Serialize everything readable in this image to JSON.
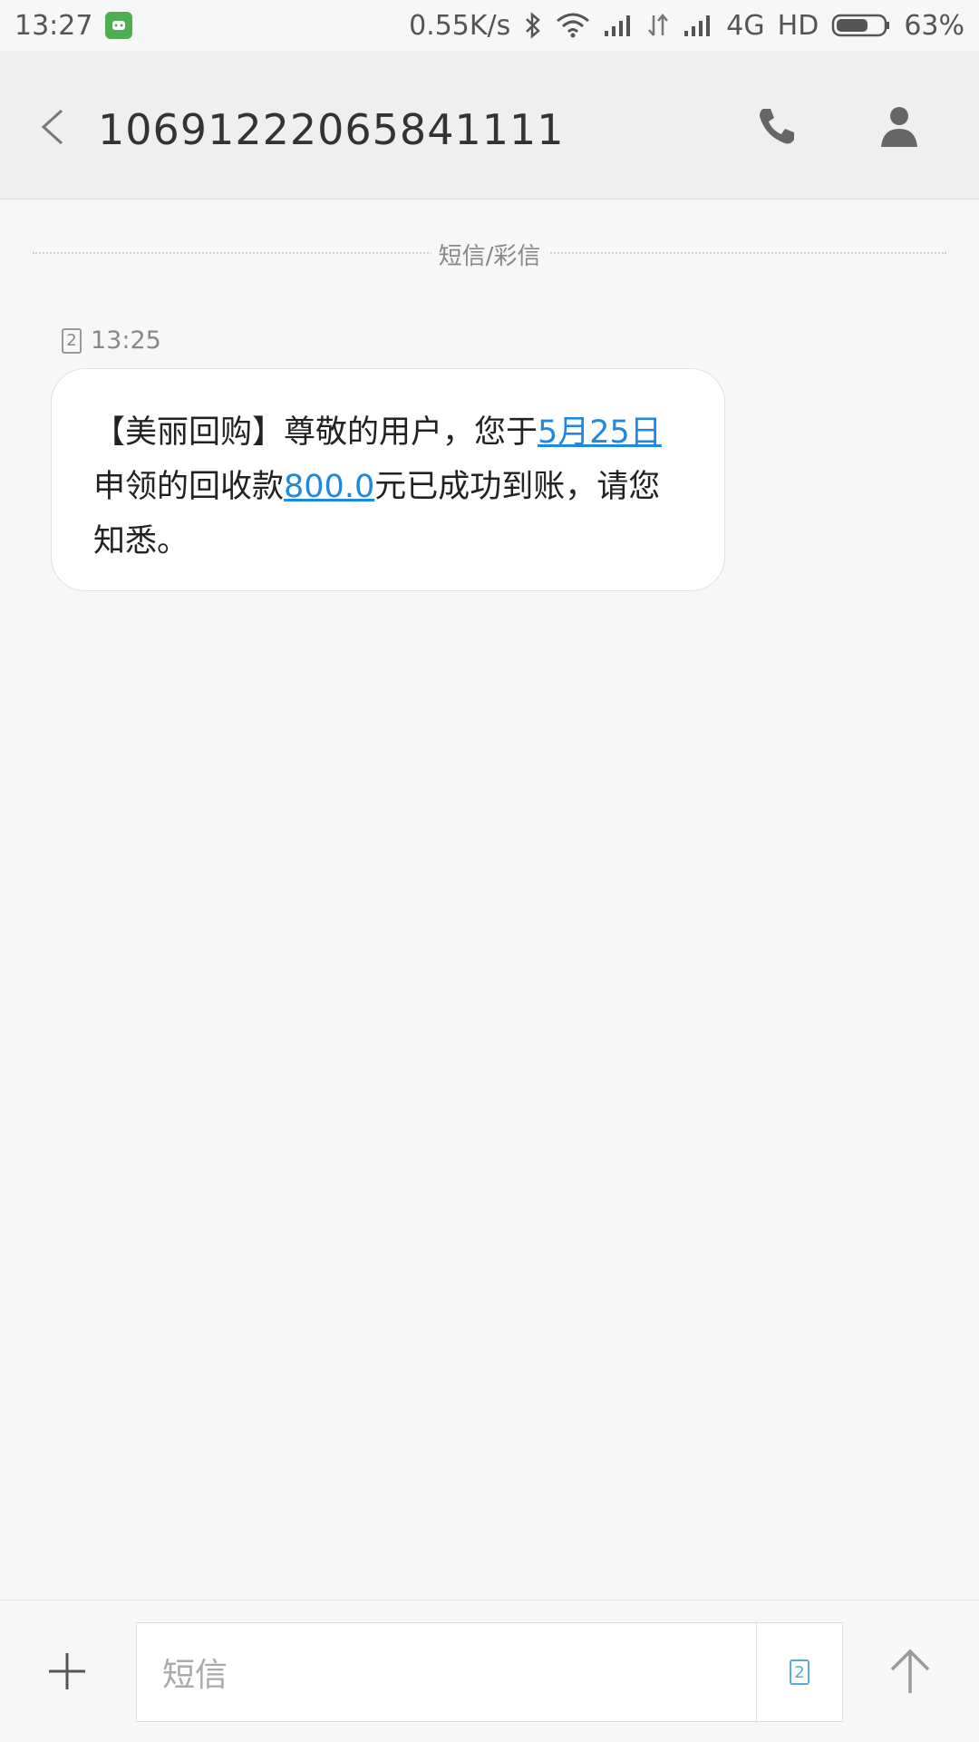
{
  "status_bar": {
    "time": "13:27",
    "net_speed": "0.55K/s",
    "network_type": "4G",
    "hd": "HD",
    "battery": "63%"
  },
  "header": {
    "title": "10691222065841111"
  },
  "divider": {
    "label": "短信/彩信"
  },
  "message": {
    "sim": "2",
    "time": "13:25",
    "text_part1": "【美丽回购】尊敬的用户，您于",
    "link_date": "5月25日",
    "text_part2": "申领的回收款",
    "link_amount": "800.0",
    "text_part3": "元已成功到账，请您知悉。"
  },
  "composer": {
    "placeholder": "短信",
    "sim": "2"
  },
  "colors": {
    "link": "#1e88e5",
    "app_badge": "#4caf50",
    "sim_active": "#5aa9d6"
  },
  "icons": [
    "app-badge-icon",
    "bluetooth-icon",
    "wifi-icon",
    "signal-icon",
    "data-arrows-icon",
    "battery-icon",
    "back-icon",
    "phone-icon",
    "contact-icon",
    "plus-icon",
    "send-icon"
  ]
}
